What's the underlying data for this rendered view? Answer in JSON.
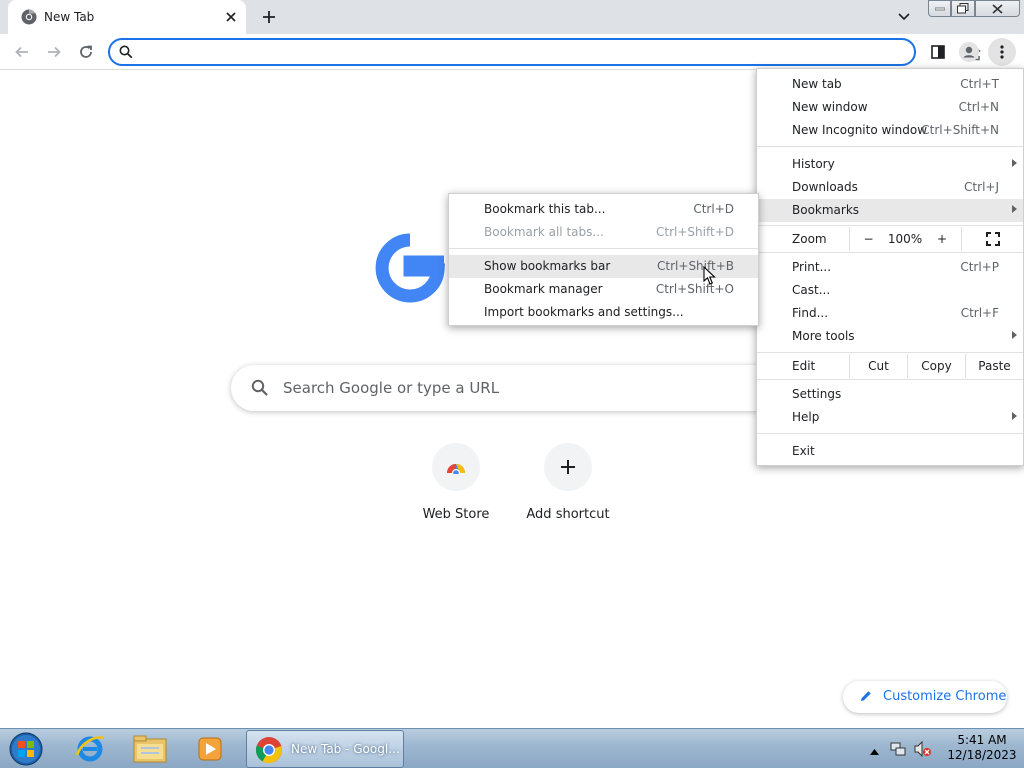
{
  "browser": {
    "tab_title": "New Tab",
    "omnibox_value": "",
    "window_controls": [
      "minimize-icon",
      "maximize-icon",
      "close-icon"
    ]
  },
  "ntp": {
    "search_placeholder": "Search Google or type a URL",
    "shortcuts": [
      {
        "label": "Web Store",
        "icon": "webstore-icon"
      },
      {
        "label": "Add shortcut",
        "icon": "plus-icon"
      }
    ],
    "customize_label": "Customize Chrome"
  },
  "main_menu": {
    "new_tab": {
      "label": "New tab",
      "shortcut": "Ctrl+T"
    },
    "new_window": {
      "label": "New window",
      "shortcut": "Ctrl+N"
    },
    "incognito": {
      "label": "New Incognito window",
      "shortcut": "Ctrl+Shift+N"
    },
    "history": {
      "label": "History"
    },
    "downloads": {
      "label": "Downloads",
      "shortcut": "Ctrl+J"
    },
    "bookmarks": {
      "label": "Bookmarks"
    },
    "zoom": {
      "label": "Zoom",
      "minus": "−",
      "value": "100%",
      "plus": "+"
    },
    "print": {
      "label": "Print...",
      "shortcut": "Ctrl+P"
    },
    "cast": {
      "label": "Cast..."
    },
    "find": {
      "label": "Find...",
      "shortcut": "Ctrl+F"
    },
    "more_tools": {
      "label": "More tools"
    },
    "edit": {
      "label": "Edit",
      "cut": "Cut",
      "copy": "Copy",
      "paste": "Paste"
    },
    "settings": {
      "label": "Settings"
    },
    "help": {
      "label": "Help"
    },
    "exit": {
      "label": "Exit"
    }
  },
  "bookmarks_menu": {
    "bookmark_tab": {
      "label": "Bookmark this tab...",
      "shortcut": "Ctrl+D"
    },
    "bookmark_all": {
      "label": "Bookmark all tabs...",
      "shortcut": "Ctrl+Shift+D"
    },
    "show_bar": {
      "label": "Show bookmarks bar",
      "shortcut": "Ctrl+Shift+B"
    },
    "manager": {
      "label": "Bookmark manager",
      "shortcut": "Ctrl+Shift+O"
    },
    "import": {
      "label": "Import bookmarks and settings..."
    }
  },
  "taskbar": {
    "chrome_label": "New Tab - Googl...",
    "time": "5:41 AM",
    "date": "12/18/2023"
  },
  "colors": {
    "accent": "#1a73e8",
    "google_blue": "#4285f4",
    "tabstrip": "#dee1e6"
  }
}
